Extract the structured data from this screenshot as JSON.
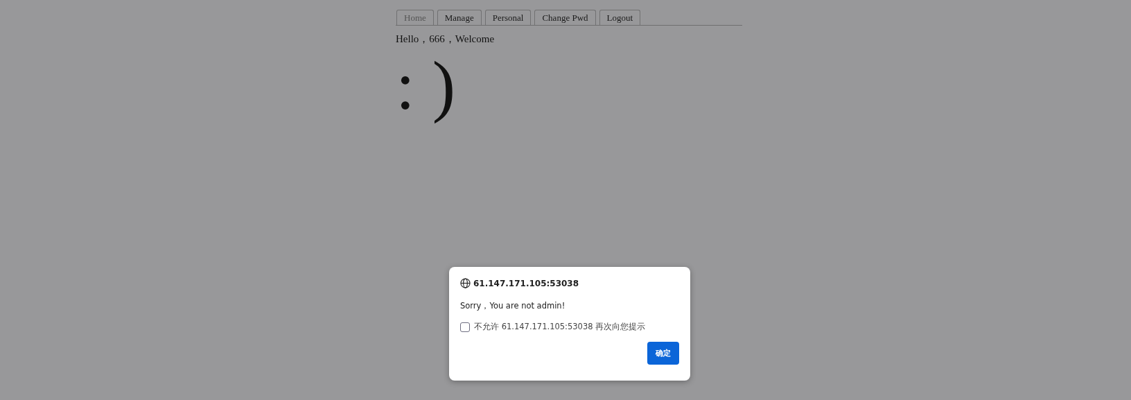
{
  "tabs": [
    {
      "label": "Home",
      "selected": true
    },
    {
      "label": "Manage",
      "selected": false
    },
    {
      "label": "Personal",
      "selected": false
    },
    {
      "label": "Change Pwd",
      "selected": false
    },
    {
      "label": "Logout",
      "selected": false
    }
  ],
  "greeting": "Hello，666，Welcome",
  "smiley": ": )",
  "dialog": {
    "origin": "61.147.171.105:53038",
    "message": "Sorry，You are not admin!",
    "checkbox": {
      "label": "不允许 61.147.171.105:53038 再次向您提示",
      "checked": false
    },
    "button": "确定"
  }
}
